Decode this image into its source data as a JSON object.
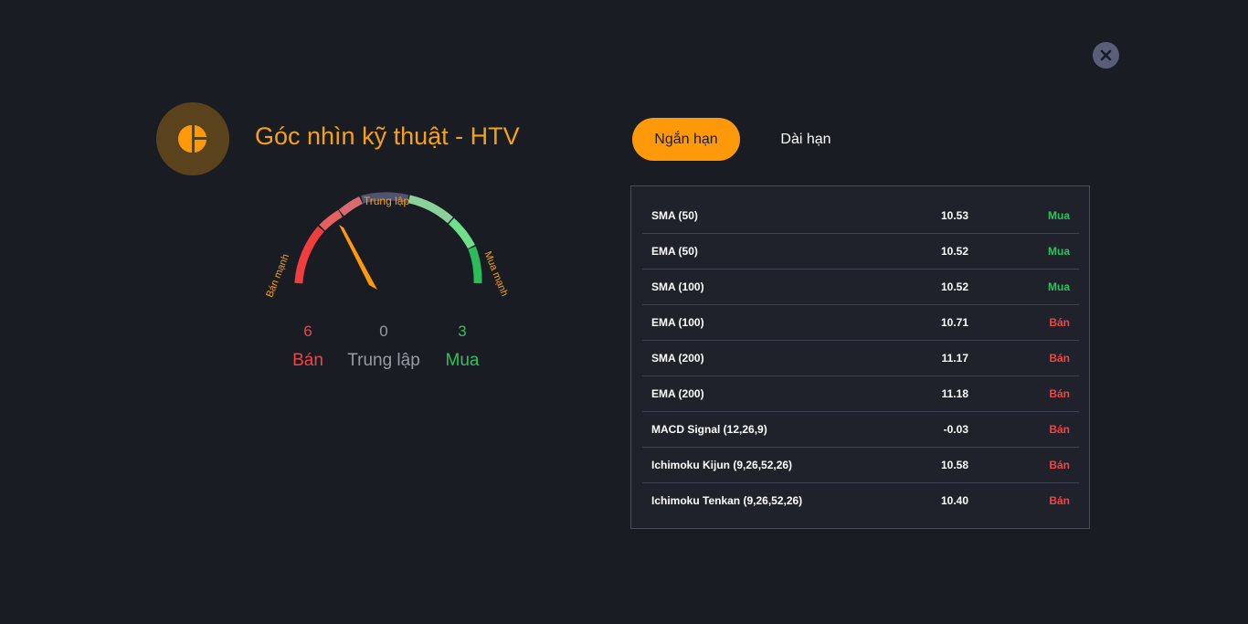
{
  "header": {
    "title": "Góc nhìn kỹ thuật - HTV",
    "logo_icon": "pie-chart-icon",
    "close_icon": "close-icon"
  },
  "gauge": {
    "top_label": "Trung lập",
    "left_label": "Bán mạnh",
    "right_label": "Mua mạnh",
    "needle_value": -0.42
  },
  "summary": {
    "sell_count": "6",
    "neutral_count": "0",
    "buy_count": "3",
    "sell_label": "Bán",
    "neutral_label": "Trung lập",
    "buy_label": "Mua"
  },
  "tabs": [
    {
      "label": "Ngắn hạn",
      "active": true
    },
    {
      "label": "Dài hạn",
      "active": false
    }
  ],
  "indicators": [
    {
      "name": "SMA (50)",
      "value": "10.53",
      "signal": "Mua"
    },
    {
      "name": "EMA (50)",
      "value": "10.52",
      "signal": "Mua"
    },
    {
      "name": "SMA (100)",
      "value": "10.52",
      "signal": "Mua"
    },
    {
      "name": "EMA (100)",
      "value": "10.71",
      "signal": "Bán"
    },
    {
      "name": "SMA (200)",
      "value": "11.17",
      "signal": "Bán"
    },
    {
      "name": "EMA (200)",
      "value": "11.18",
      "signal": "Bán"
    },
    {
      "name": "MACD Signal (12,26,9)",
      "value": "-0.03",
      "signal": "Bán"
    },
    {
      "name": "Ichimoku Kijun (9,26,52,26)",
      "value": "10.58",
      "signal": "Bán"
    },
    {
      "name": "Ichimoku Tenkan (9,26,52,26)",
      "value": "10.40",
      "signal": "Bán"
    }
  ],
  "colors": {
    "accent": "#fe9a0a",
    "buy": "#31c25c",
    "sell": "#f04545",
    "neutral": "#9a9aa6"
  }
}
